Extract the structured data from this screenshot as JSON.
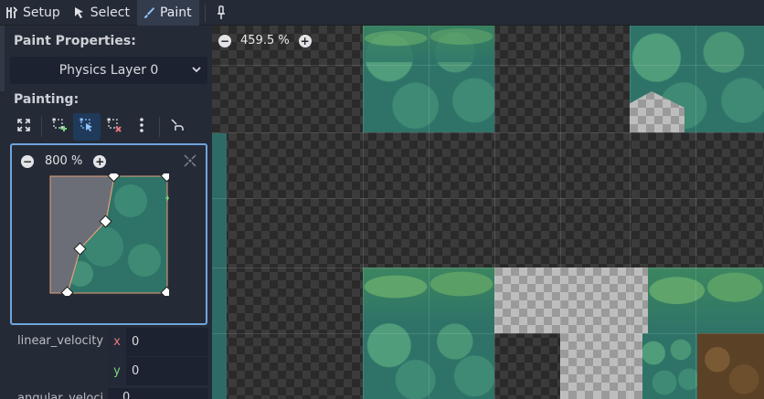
{
  "toolbar": {
    "setup_label": "Setup",
    "select_label": "Select",
    "paint_label": "Paint",
    "active_tab": "Paint",
    "icons": [
      "setup-icon",
      "select-cursor-icon",
      "paint-brush-icon",
      "pin-icon"
    ]
  },
  "panel": {
    "paint_properties_title": "Paint Properties:",
    "physics_layer_selected": "Physics Layer 0",
    "painting_title": "Painting:",
    "tool_icons": [
      "expand-icon",
      "add-points-icon",
      "edit-points-icon",
      "delete-points-icon",
      "more-options-icon",
      "flip-icon"
    ],
    "active_tool": "edit-points-icon"
  },
  "polygon_editor": {
    "zoom_label": "800 %",
    "zoom_out": "−",
    "zoom_in": "+"
  },
  "properties": {
    "linear_velocity_label": "linear_velocity",
    "x_axis": "x",
    "x_value": "0",
    "y_axis": "y",
    "y_value": "0",
    "angular_label": "angular_veloci",
    "angular_value": "0"
  },
  "viewport": {
    "zoom_label": "459.5 %",
    "zoom_out": "−",
    "zoom_in": "+"
  },
  "colors": {
    "accent": "#6fa5de",
    "active_tool_bg": "#1f3a5a",
    "panel_bg": "#252b36",
    "x_axis": "#e5787e",
    "y_axis": "#7ed37e"
  }
}
